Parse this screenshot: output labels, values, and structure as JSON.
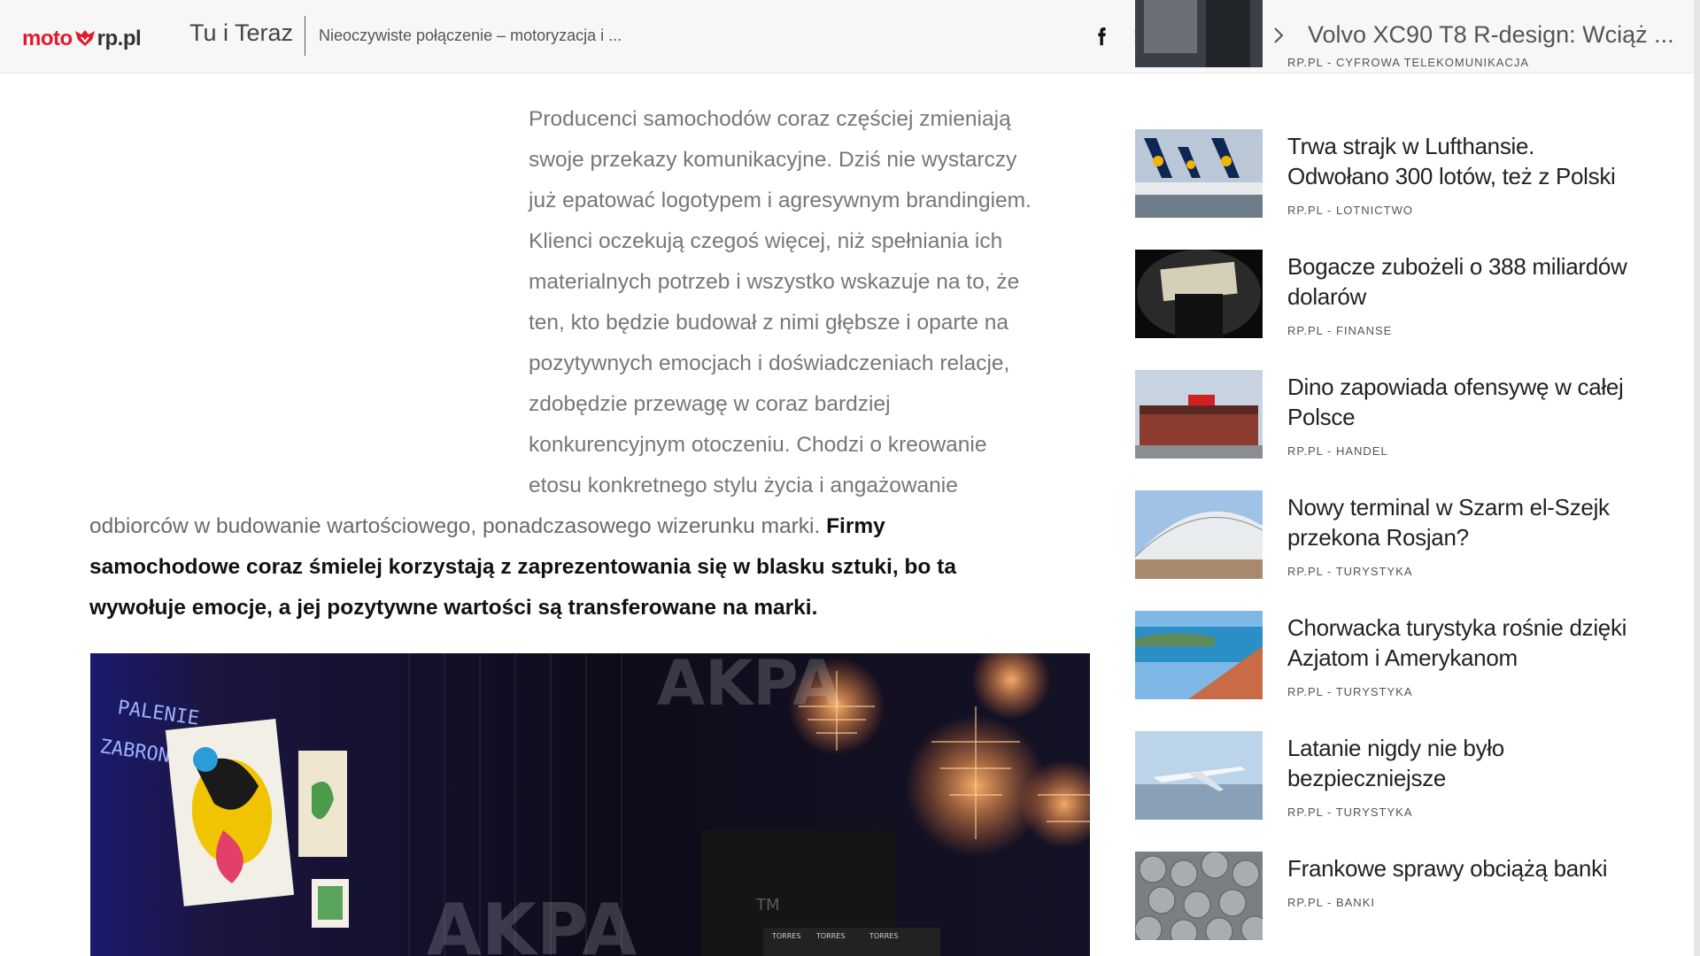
{
  "header": {
    "logo": {
      "part1": "moto",
      "part2": "rp.pl"
    },
    "section": "Tu i Teraz",
    "article_title": "Nieoczywiste połączenie – motoryzacja i ...",
    "share_icons": [
      "facebook-icon",
      "twitter-icon",
      "pinterest-icon",
      "share-arrow-icon"
    ],
    "next_article": "Volvo XC90 T8 R-design: Wciąż ..."
  },
  "article": {
    "lines_normal": [
      "Producenci samochodów coraz częściej zmieniają",
      "swoje przekazy komunikacyjne. Dziś nie wystarczy",
      "już epatować logotypem i agresywnym brandingiem.",
      "Klienci oczekują czegoś więcej, niż spełniania ich",
      "materialnych potrzeb i wszystko wskazuje na to, że",
      "ten, kto będzie budował z nimi głębsze i oparte na",
      "pozytywnych emocjach i doświadczeniach relacje,",
      "zdobędzie przewagę w coraz bardziej",
      "konkurencyjnym otoczeniu. Chodzi o kreowanie",
      "etosu konkretnego stylu życia i angażowanie"
    ],
    "last_normal": "odbiorców w budowanie wartościowego, ponadczasowego wizerunku marki.",
    "bold": "Firmy samochodowe coraz śmielej korzystają z zaprezentowania się w blasku sztuki, bo ta wywołuje emocje, a jej pozytywne wartości są transferowane na marki.",
    "hero_text": {
      "neon_line1": "PALENIE",
      "neon_line2": "ZABRONIONE",
      "watermark": "AKPA",
      "tm": "TM"
    }
  },
  "sidebar": {
    "items": [
      {
        "title": "",
        "meta": "RP.PL - CYFROWA TELEKOMUNIKACJA",
        "thumb": "business"
      },
      {
        "title": "Trwa strajk w Lufthansie. Odwołano 300 lotów, też z Polski",
        "meta": "RP.PL - LOTNICTWO",
        "thumb": "planes"
      },
      {
        "title": "Bogacze zubożeli o 388 miliardów dolarów",
        "meta": "RP.PL - FINANSE",
        "thumb": "money"
      },
      {
        "title": "Dino zapowiada ofensywę w całej Polsce",
        "meta": "RP.PL - HANDEL",
        "thumb": "store"
      },
      {
        "title": "Nowy terminal w Szarm el-Szejk przekona Rosjan?",
        "meta": "RP.PL - TURYSTYKA",
        "thumb": "terminal"
      },
      {
        "title": "Chorwacka turystyka rośnie dzięki Azjatom i Amerykanom",
        "meta": "RP.PL - TURYSTYKA",
        "thumb": "coast"
      },
      {
        "title": "Latanie nigdy nie było bezpieczniejsze",
        "meta": "RP.PL - TURYSTYKA",
        "thumb": "plane"
      },
      {
        "title": "Frankowe sprawy obciążą banki",
        "meta": "RP.PL - BANKI",
        "thumb": "coins"
      }
    ]
  },
  "colors": {
    "brand_red": "#e3192e",
    "topbar_bg": "#f7f7f7"
  }
}
